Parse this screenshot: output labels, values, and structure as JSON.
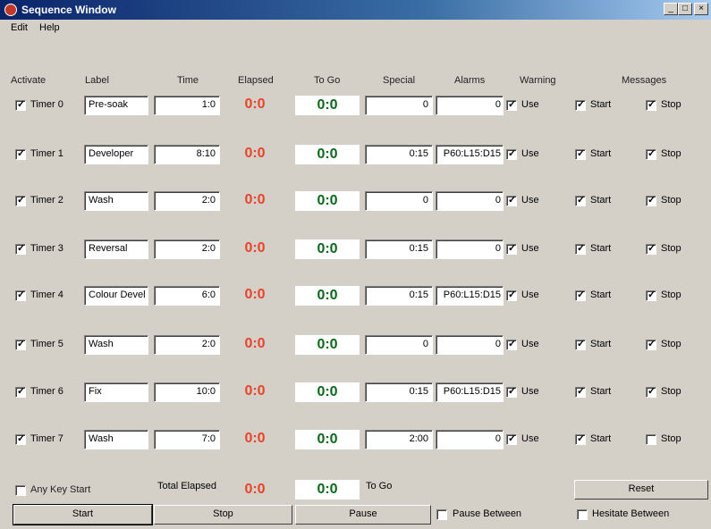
{
  "window": {
    "title": "Sequence Window",
    "minimize": "_",
    "maximize": "□",
    "close": "×"
  },
  "menu": [
    "Edit",
    "Help"
  ],
  "headers": {
    "activate": "Activate",
    "label": "Label",
    "time": "Time",
    "elapsed": "Elapsed",
    "togo": "To Go",
    "special": "Special",
    "alarms": "Alarms",
    "warning": "Warning",
    "messages": "Messages"
  },
  "timers": [
    {
      "name": "Timer 0",
      "active": true,
      "label": "Pre-soak",
      "time": "1:0",
      "elapsed": "0:0",
      "togo": "0:0",
      "special": "0",
      "alarms": "0",
      "warning_use": true,
      "use_label": "Use",
      "msg_start": true,
      "start_label": "Start",
      "msg_stop": true,
      "stop_label": "Stop"
    },
    {
      "name": "Timer 1",
      "active": true,
      "label": "Developer",
      "time": "8:10",
      "elapsed": "0:0",
      "togo": "0:0",
      "special": "0:15",
      "alarms": "P60:L15:D15",
      "warning_use": true,
      "use_label": "Use",
      "msg_start": true,
      "start_label": "Start",
      "msg_stop": true,
      "stop_label": "Stop"
    },
    {
      "name": "Timer 2",
      "active": true,
      "label": "Wash",
      "time": "2:0",
      "elapsed": "0:0",
      "togo": "0:0",
      "special": "0",
      "alarms": "0",
      "warning_use": true,
      "use_label": "Use",
      "msg_start": true,
      "start_label": "Start",
      "msg_stop": true,
      "stop_label": "Stop"
    },
    {
      "name": "Timer 3",
      "active": true,
      "label": "Reversal",
      "time": "2:0",
      "elapsed": "0:0",
      "togo": "0:0",
      "special": "0:15",
      "alarms": "0",
      "warning_use": true,
      "use_label": "Use",
      "msg_start": true,
      "start_label": "Start",
      "msg_stop": true,
      "stop_label": "Stop"
    },
    {
      "name": "Timer 4",
      "active": true,
      "label": "Colour Devel",
      "time": "6:0",
      "elapsed": "0:0",
      "togo": "0:0",
      "special": "0:15",
      "alarms": "P60:L15:D15",
      "warning_use": true,
      "use_label": "Use",
      "msg_start": true,
      "start_label": "Start",
      "msg_stop": true,
      "stop_label": "Stop"
    },
    {
      "name": "Timer 5",
      "active": true,
      "label": "Wash",
      "time": "2:0",
      "elapsed": "0:0",
      "togo": "0:0",
      "special": "0",
      "alarms": "0",
      "warning_use": true,
      "use_label": "Use",
      "msg_start": true,
      "start_label": "Start",
      "msg_stop": true,
      "stop_label": "Stop"
    },
    {
      "name": "Timer 6",
      "active": true,
      "label": "Fix",
      "time": "10:0",
      "elapsed": "0:0",
      "togo": "0:0",
      "special": "0:15",
      "alarms": "P60:L15:D15",
      "warning_use": true,
      "use_label": "Use",
      "msg_start": true,
      "start_label": "Start",
      "msg_stop": true,
      "stop_label": "Stop"
    },
    {
      "name": "Timer 7",
      "active": true,
      "label": "Wash",
      "time": "7:0",
      "elapsed": "0:0",
      "togo": "0:0",
      "special": "2:00",
      "alarms": "0",
      "warning_use": true,
      "use_label": "Use",
      "msg_start": true,
      "start_label": "Start",
      "msg_stop": false,
      "stop_label": "Stop"
    }
  ],
  "footer": {
    "any_key_start": "Any Key Start",
    "any_key_checked": false,
    "total_elapsed_label": "Total Elapsed",
    "total_elapsed": "0:0",
    "total_togo": "0:0",
    "togo_label": "To Go",
    "reset": "Reset",
    "start": "Start",
    "stop": "Stop",
    "pause": "Pause",
    "pause_between": "Pause Between",
    "pause_between_checked": false,
    "hesitate_between": "Hesitate Between",
    "hesitate_between_checked": false
  },
  "colors": {
    "elapsed": "#e8432b",
    "togo": "#0a6a1a",
    "titlebar": "#0a246a"
  }
}
